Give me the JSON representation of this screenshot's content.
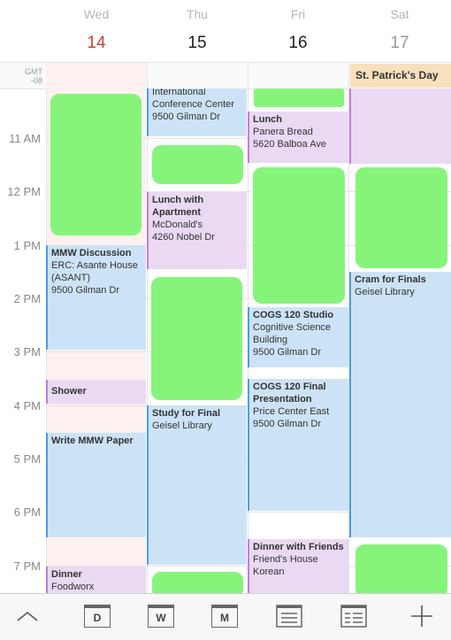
{
  "header": {
    "days": [
      {
        "name": "Wed",
        "num": "14"
      },
      {
        "name": "Thu",
        "num": "15"
      },
      {
        "name": "Fri",
        "num": "16"
      },
      {
        "name": "Sat",
        "num": "17"
      }
    ]
  },
  "timezone": {
    "line1": "GMT",
    "line2": "-08"
  },
  "all_day": {
    "sat": "St. Patrick's Day"
  },
  "time_labels": [
    "11 AM",
    "12 PM",
    "1 PM",
    "2 PM",
    "3 PM",
    "4 PM",
    "5 PM",
    "6 PM",
    "7 PM"
  ],
  "events": {
    "thu_conf": {
      "title": "International",
      "line1": "Conference Center",
      "line2": "9500 Gilman Dr"
    },
    "fri_lunch": {
      "title": "Lunch",
      "line1": "Panera Bread",
      "line2": "5620 Balboa Ave"
    },
    "thu_lunch": {
      "title": "Lunch with Apartment",
      "line1": "McDonald's",
      "line2": "4260 Nobel Dr"
    },
    "wed_mmw": {
      "title": "MMW Discussion",
      "line1": "ERC: Asante House (ASANT)",
      "line2": "9500 Gilman Dr"
    },
    "sat_cram": {
      "title": "Cram for Finals",
      "line1": "Geisel Library"
    },
    "fri_cogs_studio": {
      "title": "COGS 120 Studio",
      "line1": "Cognitive Science Building",
      "line2": "9500 Gilman Dr"
    },
    "fri_cogs_final": {
      "title": "COGS 120 Final Presentation",
      "line1": "Price Center East",
      "line2": "9500 Gilman Dr"
    },
    "wed_shower": {
      "title": "Shower"
    },
    "thu_study": {
      "title": "Study for Final",
      "line1": "Geisel Library"
    },
    "wed_paper": {
      "title": "Write MMW Paper"
    },
    "fri_dinner": {
      "title": "Dinner with Friends",
      "line1": "Friend's House Korean"
    },
    "wed_dinner": {
      "title": "Dinner",
      "line1": "Foodworx"
    }
  },
  "toolbar": {
    "day_label": "D",
    "week_label": "W",
    "month_label": "M"
  }
}
